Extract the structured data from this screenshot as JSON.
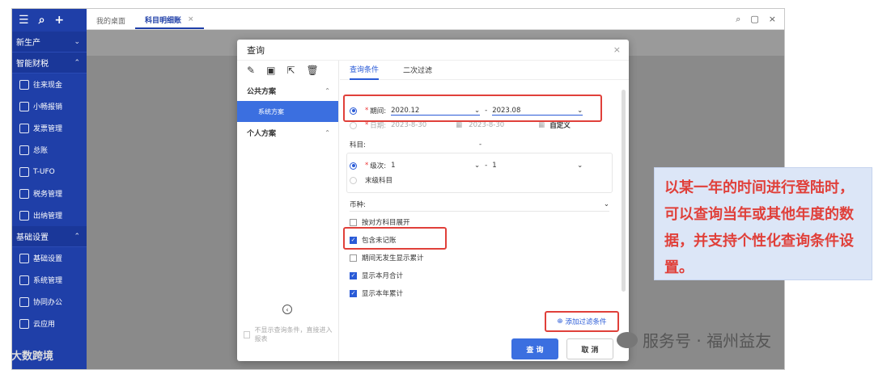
{
  "sidebar": {
    "top_icons": [
      "menu-icon",
      "search-icon",
      "plus-icon"
    ],
    "sections": [
      {
        "label": "新生产",
        "chevron": "⌄"
      },
      {
        "label": "智能财税",
        "chevron": "⌃"
      }
    ],
    "items1": [
      "往来现金",
      "小畅报销",
      "发票管理",
      "总账",
      "T-UFO",
      "税务管理",
      "出纳管理"
    ],
    "section3": {
      "label": "基础设置",
      "chevron": "⌃"
    },
    "items2": [
      "基础设置",
      "系统管理",
      "协同办公",
      "云应用"
    ]
  },
  "tabs": [
    {
      "label": "我的桌面"
    },
    {
      "label": "科目明细账"
    }
  ],
  "modal": {
    "title": "查询",
    "left": {
      "public_group": "公共方案",
      "system_scheme": "系统方案",
      "personal_group": "个人方案",
      "footer_note": "不显示查询条件，直接进入报表"
    },
    "tabs": [
      "查询条件",
      "二次过滤"
    ],
    "period": {
      "label": "期间:",
      "from": "2020.12",
      "to": "2023.08",
      "sep": "-"
    },
    "date": {
      "label": "日期:",
      "from": "2023-8-30",
      "to": "2023-8-30",
      "mode": "自定义"
    },
    "subject": {
      "label": "科目:",
      "sep": "-"
    },
    "level": {
      "label": "级次:",
      "from": "1",
      "to": "1",
      "sep": "-"
    },
    "leaf": "末级科目",
    "currency": "币种:",
    "checks": [
      {
        "label": "按对方科目展开",
        "on": false
      },
      {
        "label": "包含未记账",
        "on": true
      },
      {
        "label": "期间无发生显示累计",
        "on": false
      },
      {
        "label": "显示本月合计",
        "on": true
      },
      {
        "label": "显示本年累计",
        "on": true
      }
    ],
    "add_filter": "添加过滤条件",
    "query_button": "查 询",
    "cancel_button": "取 消"
  },
  "callout": "以某一年的时间进行登陆时，可以查询当年或其他年度的数据，并支持个性化查询条件设置。",
  "watermark_right": "服务号 · 福州益友",
  "watermark_left": "大数跨境"
}
